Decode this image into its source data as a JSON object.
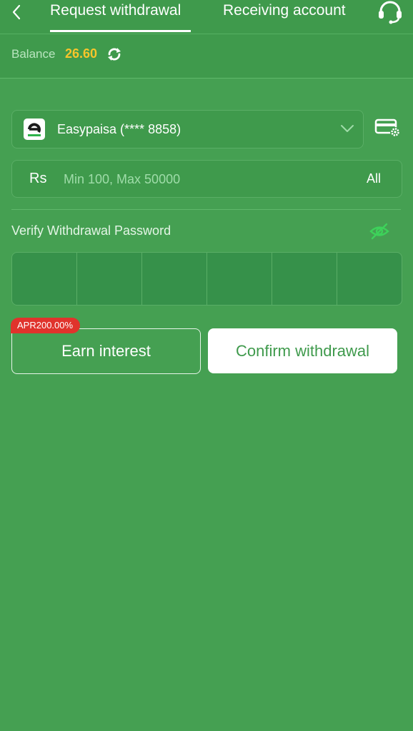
{
  "header": {
    "tabs": [
      {
        "label": "Request withdrawal",
        "active": true
      },
      {
        "label": "Receiving account",
        "active": false
      }
    ],
    "back_icon": "chevron-left-icon",
    "support_icon": "headset-icon"
  },
  "balance": {
    "label": "Balance",
    "value": "26.60",
    "refresh_icon": "refresh-icon"
  },
  "account_select": {
    "selected": "Easypaisa (**** 8858)",
    "logo_icon": "easypaisa-logo-icon",
    "dropdown_icon": "chevron-down-icon",
    "manage_icon": "card-settings-icon"
  },
  "amount": {
    "currency": "Rs",
    "placeholder": "Min 100, Max 50000",
    "all_label": "All"
  },
  "password": {
    "label": "Verify Withdrawal Password",
    "visibility_icon": "eye-off-icon",
    "cells": [
      "",
      "",
      "",
      "",
      "",
      ""
    ]
  },
  "actions": {
    "earn_label": "Earn interest",
    "apr_badge": "APR200.00%",
    "confirm_label": "Confirm withdrawal"
  },
  "colors": {
    "background": "#45a052",
    "balance_value": "#f7c52b",
    "badge": "#e0332c",
    "button_text": "#3f9a4c"
  }
}
